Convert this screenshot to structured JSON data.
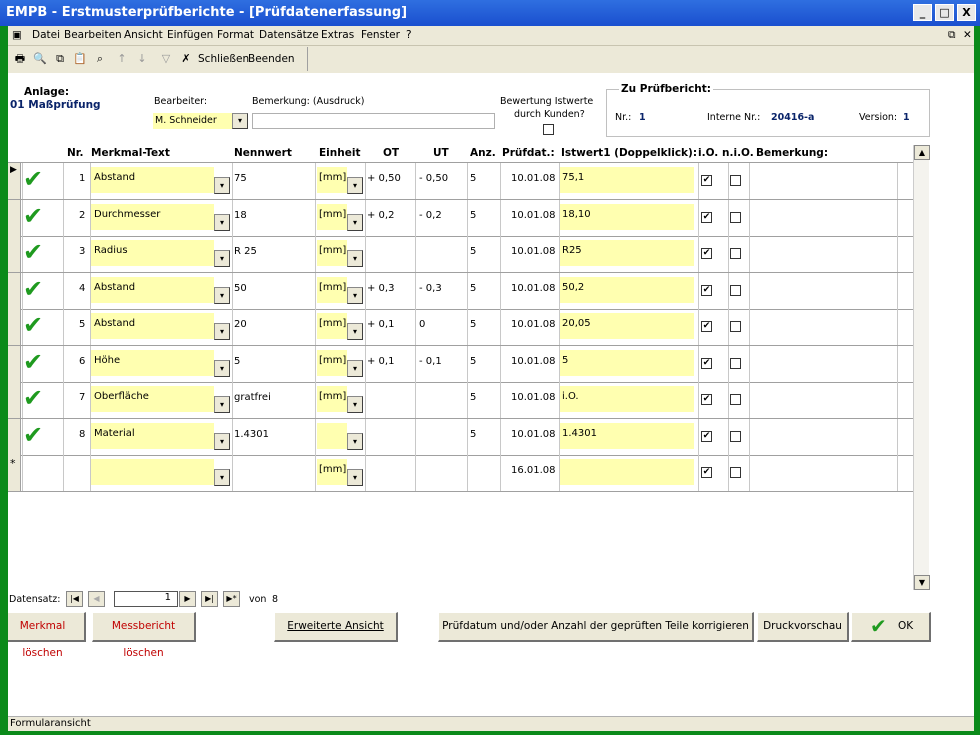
{
  "window": {
    "title": "EMPB - Erstmusterprüfberichte - [Prüfdatenerfassung]",
    "btn_min": "_",
    "btn_max": "□",
    "btn_close": "X"
  },
  "menu": {
    "file": "Datei",
    "edit": "Bearbeiten",
    "view": "Ansicht",
    "insert": "Einfügen",
    "format": "Format",
    "records": "Datensätze",
    "extras": "Extras",
    "window": "Fenster",
    "help": "?"
  },
  "toolbar": {
    "close_label": "Schließen",
    "exit_label": "Beenden"
  },
  "header": {
    "anlage_label": "Anlage:",
    "anlage_value": "01 Maßprüfung",
    "bearbeiter_label": "Bearbeiter:",
    "bearbeiter_value": "M. Schneider",
    "bemerkung_label": "Bemerkung: (Ausdruck)",
    "bemerkung_value": "",
    "bewertung_label_1": "Bewertung Istwerte",
    "bewertung_label_2": "durch Kunden?",
    "zu_label": "Zu Prüfbericht:",
    "nr_label": "Nr.:",
    "nr_value": "1",
    "intern_label": "Interne Nr.:",
    "intern_value": "20416-a",
    "version_label": "Version:",
    "version_value": "1"
  },
  "columns": [
    "Nr.",
    "Merkmal-Text",
    "Nennwert",
    "Einheit",
    "OT",
    "UT",
    "Anz.",
    "Prüfdat.:",
    "Istwert1 (Doppelklick):",
    "i.O.",
    "n.i.O.",
    "Bemerkung:"
  ],
  "rows": [
    {
      "nr": "1",
      "merkmal": "Abstand",
      "nennwert": "75",
      "einheit": "[mm]",
      "ot": "+ 0,50",
      "ut": "- 0,50",
      "anz": "5",
      "datum": "10.01.08",
      "istwert": "75,1",
      "io": true,
      "nio": false
    },
    {
      "nr": "2",
      "merkmal": "Durchmesser",
      "nennwert": "18",
      "einheit": "[mm]",
      "ot": "+ 0,2",
      "ut": "- 0,2",
      "anz": "5",
      "datum": "10.01.08",
      "istwert": "18,10",
      "io": true,
      "nio": false
    },
    {
      "nr": "3",
      "merkmal": "Radius",
      "nennwert": "R 25",
      "einheit": "[mm]",
      "ot": "",
      "ut": "",
      "anz": "5",
      "datum": "10.01.08",
      "istwert": "R25",
      "io": true,
      "nio": false
    },
    {
      "nr": "4",
      "merkmal": "Abstand",
      "nennwert": "50",
      "einheit": "[mm]",
      "ot": "+ 0,3",
      "ut": "- 0,3",
      "anz": "5",
      "datum": "10.01.08",
      "istwert": "50,2",
      "io": true,
      "nio": false
    },
    {
      "nr": "5",
      "merkmal": "Abstand",
      "nennwert": "20",
      "einheit": "[mm]",
      "ot": "+ 0,1",
      "ut": "0",
      "anz": "5",
      "datum": "10.01.08",
      "istwert": "20,05",
      "io": true,
      "nio": false
    },
    {
      "nr": "6",
      "merkmal": "Höhe",
      "nennwert": "5",
      "einheit": "[mm]",
      "ot": "+ 0,1",
      "ut": "- 0,1",
      "anz": "5",
      "datum": "10.01.08",
      "istwert": "5",
      "io": true,
      "nio": false
    },
    {
      "nr": "7",
      "merkmal": "Oberfläche",
      "nennwert": "gratfrei",
      "einheit": "[mm]",
      "ot": "",
      "ut": "",
      "anz": "5",
      "datum": "10.01.08",
      "istwert": "i.O.",
      "io": true,
      "nio": false
    },
    {
      "nr": "8",
      "merkmal": "Material",
      "nennwert": "1.4301",
      "einheit": "",
      "ot": "",
      "ut": "",
      "anz": "5",
      "datum": "10.01.08",
      "istwert": "1.4301",
      "io": true,
      "nio": false
    }
  ],
  "new_row": {
    "marker": "*",
    "einheit": "[mm]",
    "datum": "16.01.08",
    "io": true,
    "nio": false
  },
  "navigator": {
    "label": "Datensatz:",
    "current": "1",
    "of_label": "von",
    "total": "8"
  },
  "buttons": {
    "delete_feature": "Merkmal löschen",
    "delete_report": "Messbericht löschen",
    "extended_view": "Erweiterte Ansicht",
    "correct": "Prüfdatum und/oder Anzahl der geprüften Teile korrigieren",
    "preview": "Druckvorschau",
    "ok": "OK"
  },
  "status": {
    "text": "Formularansicht"
  },
  "colors": {
    "field_yellow": "#ffffb0",
    "check_green": "#1f9a1f",
    "label_blue": "#0a246a",
    "danger_red": "#c00000"
  }
}
